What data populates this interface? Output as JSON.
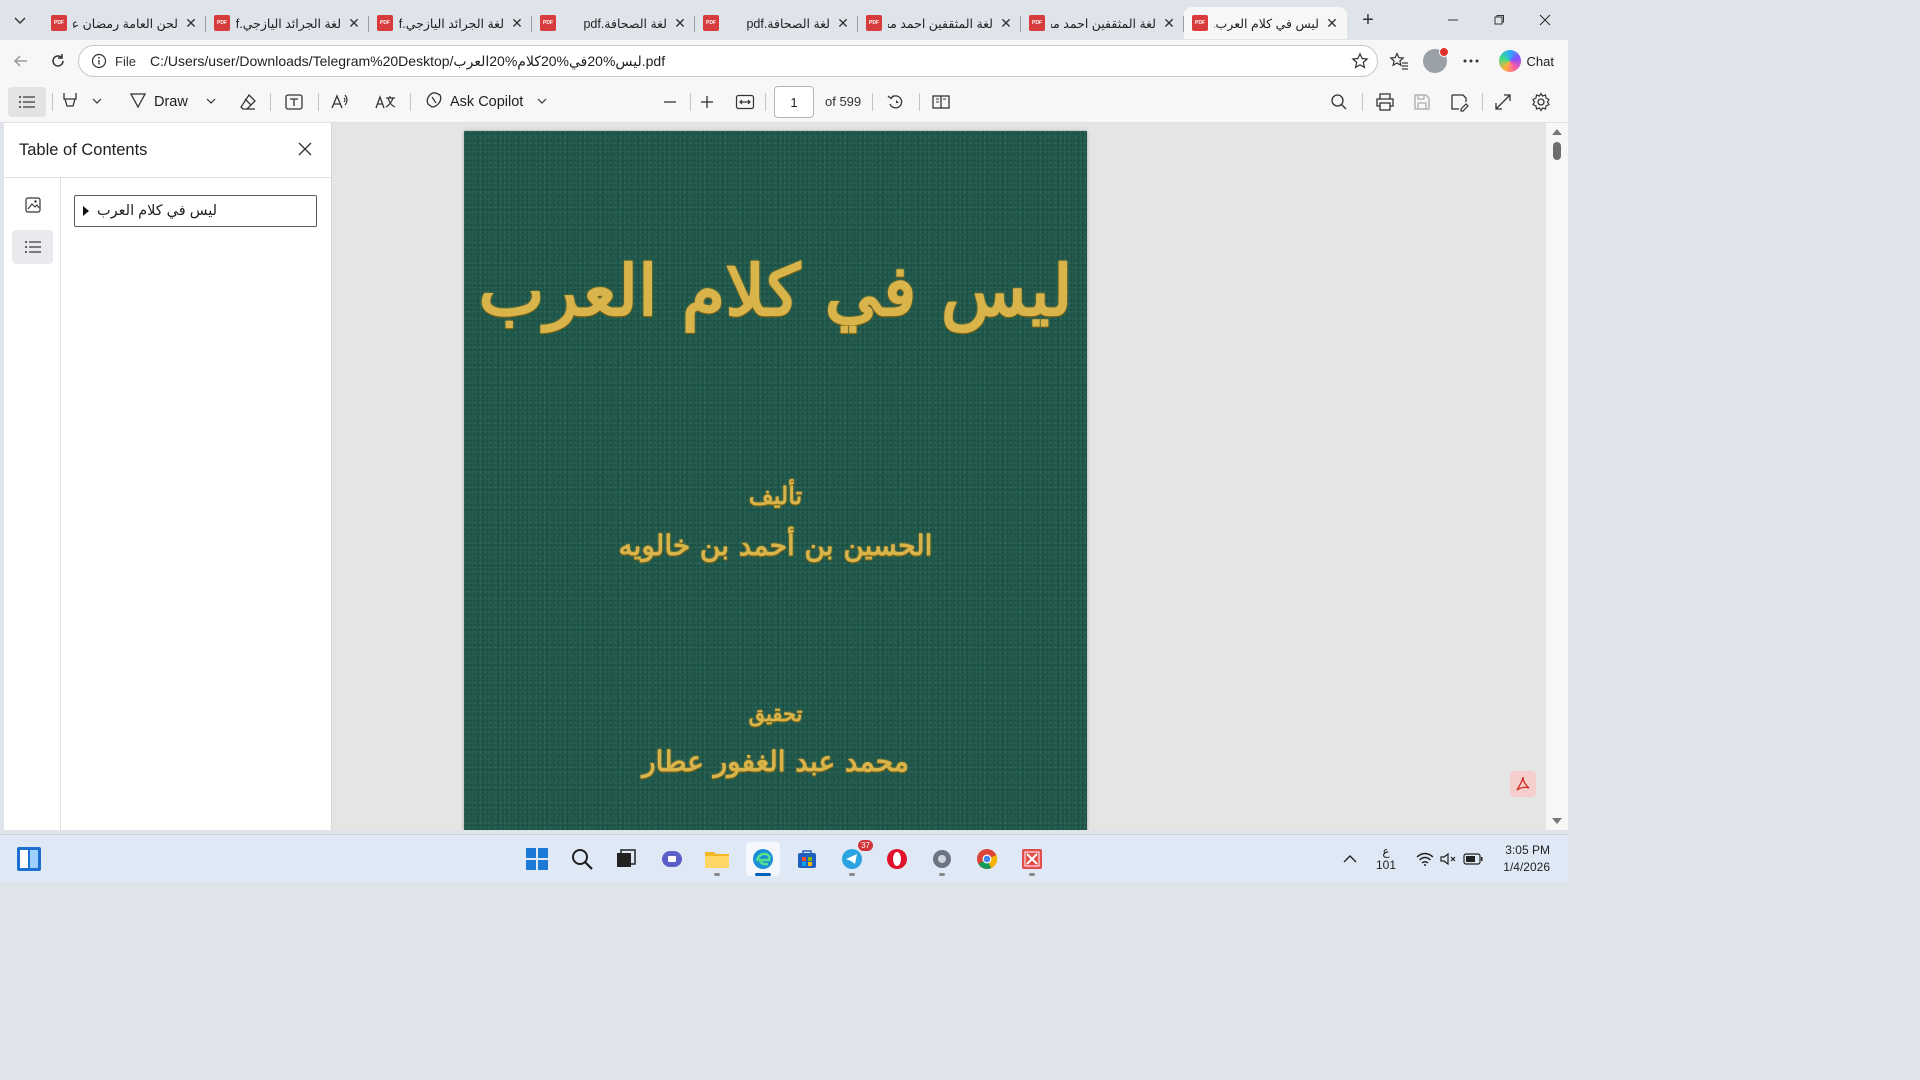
{
  "browser": {
    "tabs": [
      {
        "title": "لحن العامة رمضان عبد",
        "active": false
      },
      {
        "title": "لغة الجرائد اليازجي.pdf",
        "active": false
      },
      {
        "title": "لغة الجرائد اليازجي.pdf",
        "active": false
      },
      {
        "title": "لغة الصحافة.pdf",
        "active": false
      },
      {
        "title": "لغة الصحافة.pdf",
        "active": false
      },
      {
        "title": "لغة المثقفين احمد مختار",
        "active": false
      },
      {
        "title": "لغة المثقفين احمد مختار",
        "active": false
      },
      {
        "title": "ليس في كلام العرب.pdf",
        "active": true
      }
    ],
    "address": {
      "scheme_label": "File",
      "url": "C:/Users/user/Downloads/Telegram%20Desktop/ليس%20في%20كلام%20العرب.pdf"
    },
    "chat_label": "Chat"
  },
  "pdf_toolbar": {
    "draw_label": "Draw",
    "copilot_label": "Ask Copilot",
    "page_number": "1",
    "page_total": "of 599"
  },
  "sidebar": {
    "title": "Table of Contents",
    "toc": [
      {
        "label": "ليس في كلام العرب"
      }
    ]
  },
  "document": {
    "cover_title": "ليس في كلام العرب",
    "cover_lines": [
      "تأليف",
      "الحسين بن أحمد بن خالويه",
      "تحقيق",
      "محمد عبد الغفور عطار"
    ],
    "cover_color": "#1f5a4c",
    "text_color": "#d9b44a"
  },
  "taskbar": {
    "telegram_badge": "37",
    "ime_lang": "ع",
    "ime_sub": "101",
    "time": "3:05 PM",
    "date": "1/4/2026"
  },
  "icons": [
    "tab-list-icon",
    "pdf-icon",
    "close-icon",
    "plus-icon",
    "minimize-icon",
    "maximize-icon",
    "back-icon",
    "refresh-icon",
    "info-icon",
    "star-icon",
    "favorites-icon",
    "more-icon",
    "contents-icon",
    "highlight-icon",
    "draw-icon",
    "eraser-icon",
    "text-icon",
    "read-aloud-icon",
    "translate-icon",
    "copilot-icon",
    "zoom-out-icon",
    "zoom-in-icon",
    "fit-width-icon",
    "rotate-icon",
    "page-view-icon",
    "search-icon",
    "print-icon",
    "save-icon",
    "save-as-icon",
    "fullscreen-icon",
    "settings-icon",
    "thumbnail-icon",
    "outline-icon",
    "adobe-icon"
  ]
}
